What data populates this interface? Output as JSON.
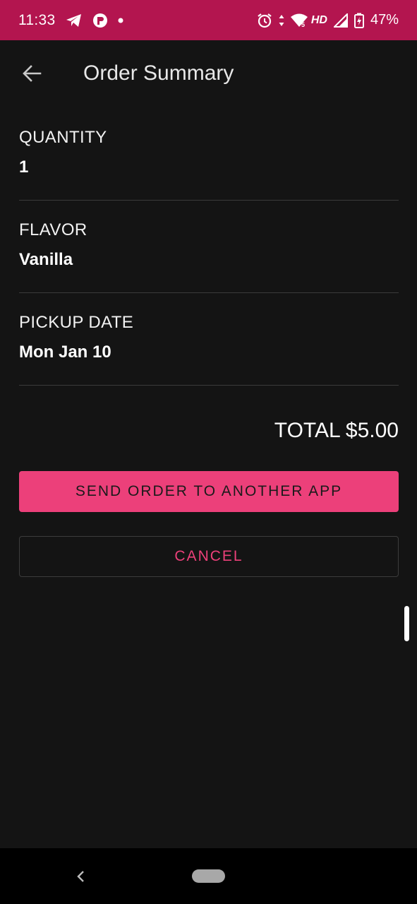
{
  "status_bar": {
    "time": "11:33",
    "network": "HD",
    "battery": "47%",
    "bg_color": "#b3154f",
    "left_icons": [
      "telegram-icon",
      "app-notification-icon",
      "dot-icon"
    ],
    "right_icons": [
      "alarm-icon",
      "data-arrows-icon",
      "wifi-icon",
      "signal-icon",
      "battery-icon"
    ]
  },
  "app_bar": {
    "title": "Order Summary",
    "back_icon": "arrow-back-icon"
  },
  "summary": {
    "quantity": {
      "label": "QUANTITY",
      "value": "1"
    },
    "flavor": {
      "label": "FLAVOR",
      "value": "Vanilla"
    },
    "pickup_date": {
      "label": "PICKUP DATE",
      "value": "Mon Jan 10"
    }
  },
  "total": "TOTAL $5.00",
  "buttons": {
    "send": "SEND ORDER TO ANOTHER APP",
    "cancel": "CANCEL"
  },
  "colors": {
    "accent": "#ec407a",
    "background": "#141414",
    "divider": "#3a3a3a"
  },
  "nav_bar": {
    "back_icon": "nav-back-icon",
    "home_icon": "nav-home-pill"
  }
}
